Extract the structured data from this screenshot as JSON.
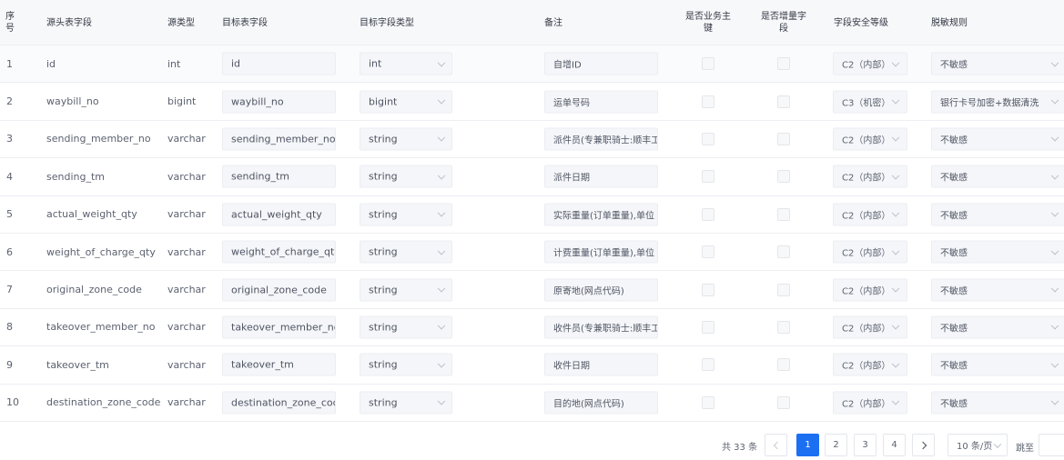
{
  "table": {
    "headers": {
      "index": "序\n号",
      "source_field": "源头表字段",
      "source_type": "源类型",
      "target_field": "目标表字段",
      "target_type": "目标字段类型",
      "remark": "备注",
      "is_business_key": "是否业务主\n键",
      "is_increment": "是否增量字\n段",
      "security_level": "字段安全等级",
      "desensitize_rule": "脱敏规则"
    },
    "rows": [
      {
        "index": "1",
        "source_field": "id",
        "source_type": "int",
        "target_field": "id",
        "target_type": "int",
        "remark": "自增ID",
        "security_level": "C2（内部）",
        "desensitize_rule": "不敏感"
      },
      {
        "index": "2",
        "source_field": "waybill_no",
        "source_type": "bigint",
        "target_field": "waybill_no",
        "target_type": "bigint",
        "remark": "运单号码",
        "security_level": "C3（机密）",
        "desensitize_rule": "银行卡号加密+数据清洗"
      },
      {
        "index": "3",
        "source_field": "sending_member_no",
        "source_type": "varchar",
        "target_field": "sending_member_no",
        "target_type": "string",
        "remark": "派件员(专兼职骑士:顺丰工",
        "security_level": "C2（内部）",
        "desensitize_rule": "不敏感"
      },
      {
        "index": "4",
        "source_field": "sending_tm",
        "source_type": "varchar",
        "target_field": "sending_tm",
        "target_type": "string",
        "remark": "派件日期",
        "security_level": "C2（内部）",
        "desensitize_rule": "不敏感"
      },
      {
        "index": "5",
        "source_field": "actual_weight_qty",
        "source_type": "varchar",
        "target_field": "actual_weight_qty",
        "target_type": "string",
        "remark": "实际重量(订单重量),单位",
        "security_level": "C2（内部）",
        "desensitize_rule": "不敏感"
      },
      {
        "index": "6",
        "source_field": "weight_of_charge_qty",
        "source_type": "varchar",
        "target_field": "weight_of_charge_qty",
        "target_type": "string",
        "remark": "计费重量(订单重量),单位",
        "security_level": "C2（内部）",
        "desensitize_rule": "不敏感"
      },
      {
        "index": "7",
        "source_field": "original_zone_code",
        "source_type": "varchar",
        "target_field": "original_zone_code",
        "target_type": "string",
        "remark": "原寄地(网点代码)",
        "security_level": "C2（内部）",
        "desensitize_rule": "不敏感"
      },
      {
        "index": "8",
        "source_field": "takeover_member_no",
        "source_type": "varchar",
        "target_field": "takeover_member_no",
        "target_type": "string",
        "remark": "收件员(专兼职骑士:顺丰工",
        "security_level": "C2（内部）",
        "desensitize_rule": "不敏感"
      },
      {
        "index": "9",
        "source_field": "takeover_tm",
        "source_type": "varchar",
        "target_field": "takeover_tm",
        "target_type": "string",
        "remark": "收件日期",
        "security_level": "C2（内部）",
        "desensitize_rule": "不敏感"
      },
      {
        "index": "10",
        "source_field": "destination_zone_code",
        "source_type": "varchar",
        "target_field": "destination_zone_code",
        "target_type": "string",
        "remark": "目的地(网点代码)",
        "security_level": "C2（内部）",
        "desensitize_rule": "不敏感"
      }
    ]
  },
  "pagination": {
    "total_text": "共 33 条",
    "pages": [
      "1",
      "2",
      "3",
      "4"
    ],
    "current_page": "1",
    "page_size_label": "10 条/页",
    "jump_label": "跳至",
    "prev_icon": "chevron-left-icon",
    "next_icon": "chevron-right-icon"
  },
  "colors": {
    "accent": "#1d6ff2",
    "header_bg": "#f7f8fa",
    "input_bg": "#f5f6f9",
    "border": "#eceef2"
  }
}
